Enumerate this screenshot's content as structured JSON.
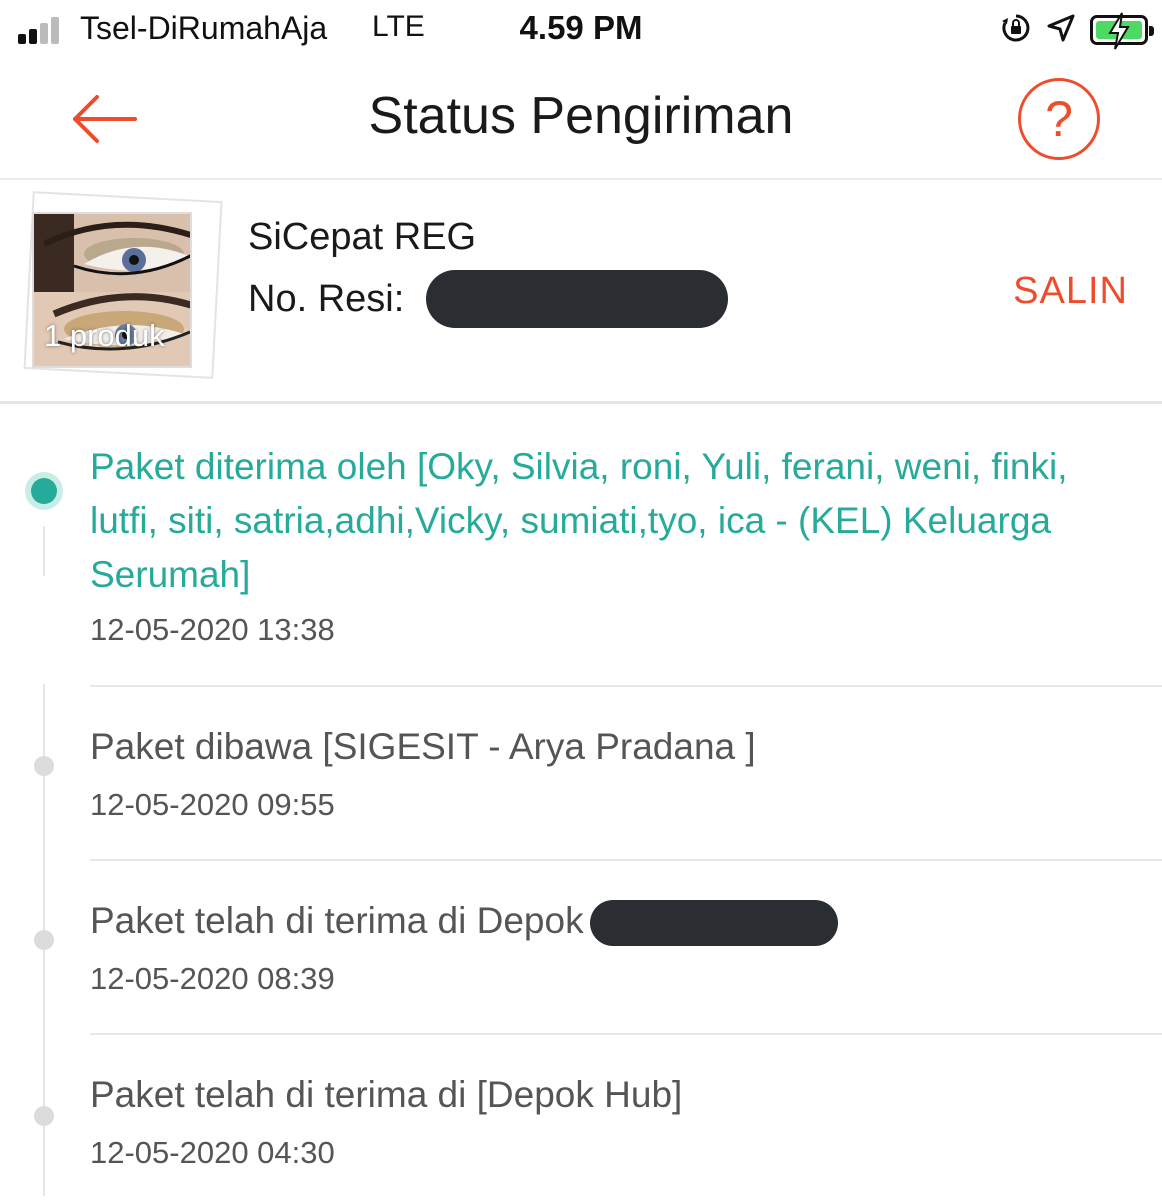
{
  "status_bar": {
    "carrier": "Tsel-DiRumahAja",
    "network": "LTE",
    "time": "4.59 PM",
    "icons": [
      "orientation-lock-icon",
      "location-arrow-icon",
      "battery-charging-icon"
    ],
    "battery_color": "#4cd964"
  },
  "header": {
    "back_icon": "arrow-left-icon",
    "title": "Status Pengiriman",
    "help_label": "?"
  },
  "package": {
    "product_count": "1 produk",
    "courier": "SiCepat REG",
    "resi_label": "No. Resi:",
    "copy_label": "SALIN"
  },
  "timeline": [
    {
      "description": "Paket diterima oleh [Oky, Silvia, roni, Yuli, ferani, weni, finki, lutfi, siti, satria,adhi,Vicky, sumiati,tyo, ica - (KEL) Keluarga Serumah]",
      "time": "12-05-2020 13:38",
      "active": true
    },
    {
      "description": "Paket dibawa [SIGESIT - Arya Pradana ]",
      "time": "12-05-2020 09:55",
      "active": false
    },
    {
      "description": "Paket telah di terima di Depok",
      "time": "12-05-2020 08:39",
      "active": false
    },
    {
      "description": "Paket telah di terima di [Depok Hub]",
      "time": "12-05-2020 04:30",
      "active": false
    }
  ],
  "colors": {
    "accent": "#ee4d2d",
    "active_status": "#26aa99",
    "inactive_text": "#555555"
  }
}
